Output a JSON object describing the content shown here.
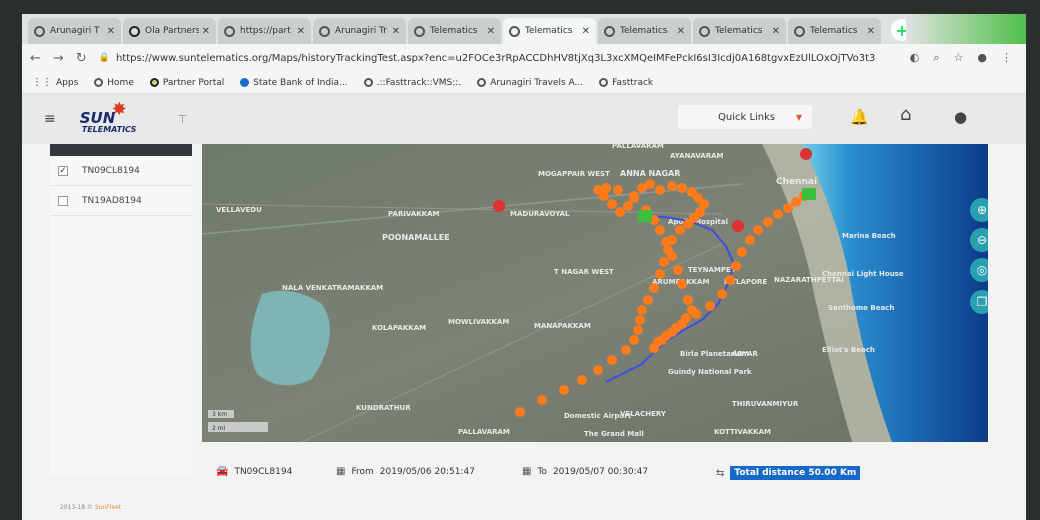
{
  "browser": {
    "tabs": [
      {
        "title": "Arunagiri T",
        "icon": "globe-icon",
        "active": false
      },
      {
        "title": "Ola Partners",
        "icon": "ola-icon",
        "active": false
      },
      {
        "title": "https://part",
        "icon": "globe-icon",
        "active": false
      },
      {
        "title": "Arunagiri Tr",
        "icon": "globe-icon",
        "active": false
      },
      {
        "title": "Telematics",
        "icon": "globe-icon",
        "active": false
      },
      {
        "title": "Telematics",
        "icon": "globe-icon",
        "active": true
      },
      {
        "title": "Telematics",
        "icon": "globe-icon",
        "active": false
      },
      {
        "title": "Telematics",
        "icon": "globe-icon",
        "active": false
      },
      {
        "title": "Telematics",
        "icon": "globe-icon",
        "active": false
      }
    ],
    "url": "https://www.suntelematics.org/Maps/historyTrackingTest.aspx?enc=u2FOCe3rRpACCDhHV8tjXq3L3xcXMQeIMFePckI6sI3Icdj0A168tgvxEzUlLOxOjTVo3t33lQur7c+DHa...",
    "bookmarks": [
      {
        "label": "Apps",
        "icon": "apps-grid-icon"
      },
      {
        "label": "Home",
        "icon": "globe-icon"
      },
      {
        "label": "Partner Portal",
        "icon": "ola-icon"
      },
      {
        "label": "State Bank of India...",
        "icon": "sbi-icon"
      },
      {
        "label": ".::Fasttrack::VMS::.",
        "icon": "globe-icon"
      },
      {
        "label": "Arunagiri Travels A...",
        "icon": "globe-icon"
      },
      {
        "label": "Fasttrack",
        "icon": "globe-icon"
      }
    ]
  },
  "app": {
    "logo_text": "SUN",
    "logo_subtext": "TELEMATICS",
    "quick_links": "Quick Links",
    "vehicles": [
      {
        "label": "TN09CL8194",
        "checked": true
      },
      {
        "label": "TN19AD8194",
        "checked": false
      }
    ],
    "map": {
      "scale_km": "3 km",
      "scale_mi": "2 mi",
      "labels": [
        "AYANAVARAM",
        "MOGAPPAIR WEST",
        "ANNA NAGAR",
        "Chennai",
        "VELLAVEDU",
        "PARIVAKKAM",
        "MADURAVOYAL",
        "Apollo Hospital",
        "POONAMALLEE",
        "ARUMBAKKAM",
        "T NAGAR WEST",
        "TEYNAMPET",
        "MYLAPORE",
        "NAZARATHPETTAI",
        "NALA VENKATRAMAKKAM",
        "KOLAPAKKAM",
        "MOWLIVAKKAM",
        "MANAPAKKAM",
        "PALLAVARAM",
        "Domestic Airport",
        "VELACHERY",
        "The Grand Mall",
        "Guindy National Park",
        "Birla Planetarium",
        "ADYAR",
        "Marina Beach",
        "Chennai Light House",
        "Santhome Beach",
        "Elliot's Beach",
        "THIRUVANMIYUR",
        "KOTTIVAKKAM",
        "KUNDRATHUR",
        "PALLAVARAM"
      ]
    },
    "footer": {
      "vehicle": "TN09CL8194",
      "from_label": "From",
      "from_value": "2019/05/06 20:51:47",
      "to_label": "To",
      "to_value": "2019/05/07 00:30:47",
      "distance_label": "Total distance",
      "distance_value": "50.00 Km"
    },
    "copyright": "2013-18 © ",
    "copyright_brand": "SunFleet"
  },
  "colors": {
    "route_dots": "#ff7a1a",
    "route_line": "#3b4fe0",
    "accent": "#1669c9",
    "map_btn": "#2a9fb0"
  }
}
